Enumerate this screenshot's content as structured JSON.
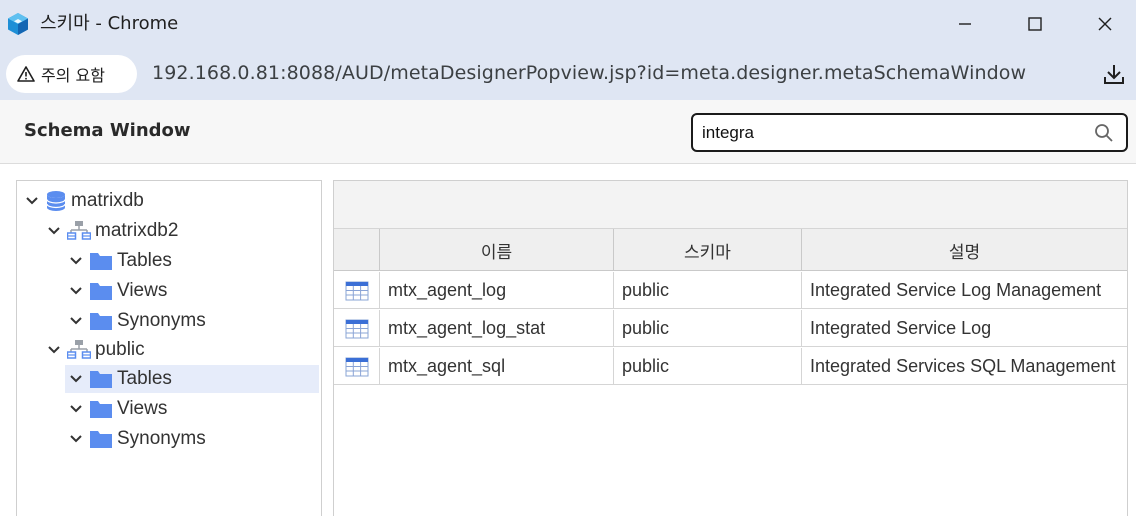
{
  "window": {
    "title": "스키마 - Chrome",
    "icon": "app-cube-icon"
  },
  "addressbar": {
    "security_label": "주의 요함",
    "url": "192.168.0.81:8088/AUD/metaDesignerPopview.jsp?id=meta.designer.metaSchemaWindow"
  },
  "page": {
    "title": "Schema Window"
  },
  "search": {
    "value": "integra"
  },
  "tree": {
    "root": "matrixdb",
    "nodes": [
      {
        "label": "matrixdb2",
        "children": [
          "Tables",
          "Views",
          "Synonyms"
        ]
      },
      {
        "label": "public",
        "children": [
          "Tables",
          "Views",
          "Synonyms"
        ]
      }
    ],
    "selected": "public/Tables"
  },
  "grid": {
    "columns": [
      "이름",
      "스키마",
      "설명"
    ],
    "rows": [
      {
        "name": "mtx_agent_log",
        "schema": "public",
        "description": "Integrated Service Log Management"
      },
      {
        "name": "mtx_agent_log_stat",
        "schema": "public",
        "description": "Integrated Service Log"
      },
      {
        "name": "mtx_agent_sql",
        "schema": "public",
        "description": "Integrated Services SQL Management"
      }
    ]
  },
  "colors": {
    "chrome_frame": "#dfe6f3",
    "folder_blue": "#5b8def",
    "selected_row": "#e6ecfa",
    "table_icon_blue": "#3b6fd6"
  }
}
